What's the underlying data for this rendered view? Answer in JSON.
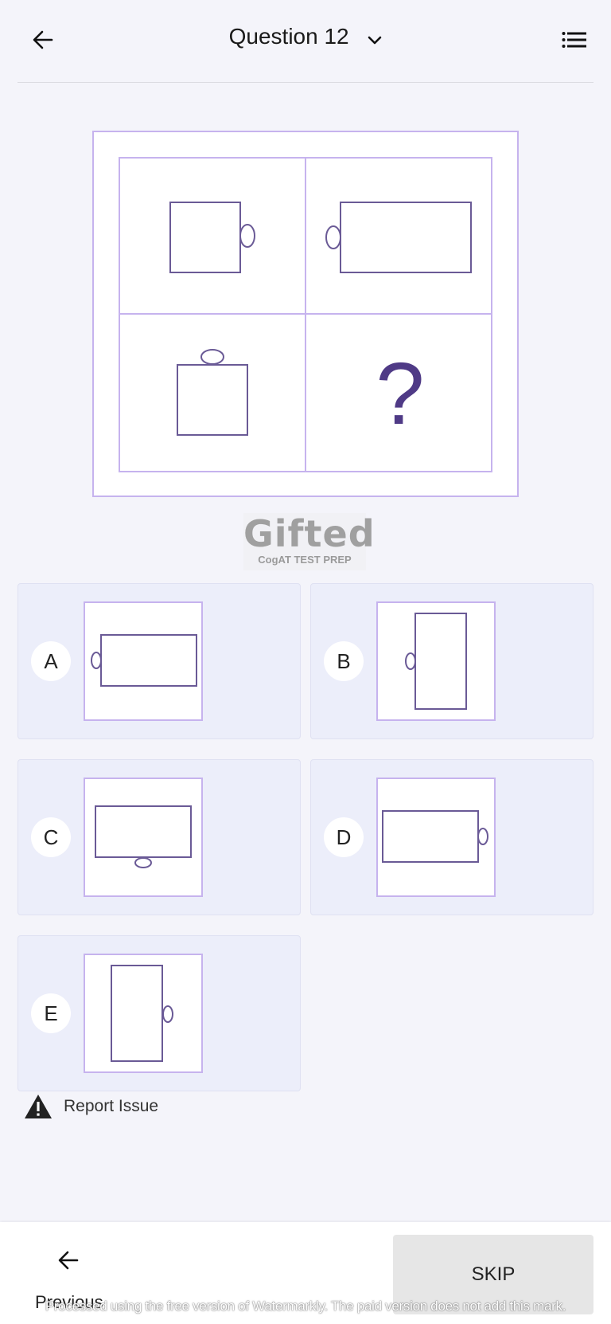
{
  "header": {
    "title": "Question 12",
    "back_icon": "arrow-left-icon",
    "dropdown_icon": "chevron-down-icon",
    "list_icon": "list-icon"
  },
  "puzzle": {
    "question_mark": "?",
    "colors": {
      "border": "#c6b3ee",
      "shape": "#6a5a96",
      "question": "#4f3a86"
    }
  },
  "logo": {
    "title": "Gifted",
    "subtitle": "CogAT TEST PREP"
  },
  "options": [
    {
      "letter": "A"
    },
    {
      "letter": "B"
    },
    {
      "letter": "C"
    },
    {
      "letter": "D"
    },
    {
      "letter": "E"
    }
  ],
  "report": {
    "label": "Report Issue",
    "icon": "warning-icon"
  },
  "footer": {
    "previous_label": "Previous",
    "skip_label": "SKIP",
    "watermark": "Processed using the free version of Watermarkly. The paid version does not add this mark."
  }
}
